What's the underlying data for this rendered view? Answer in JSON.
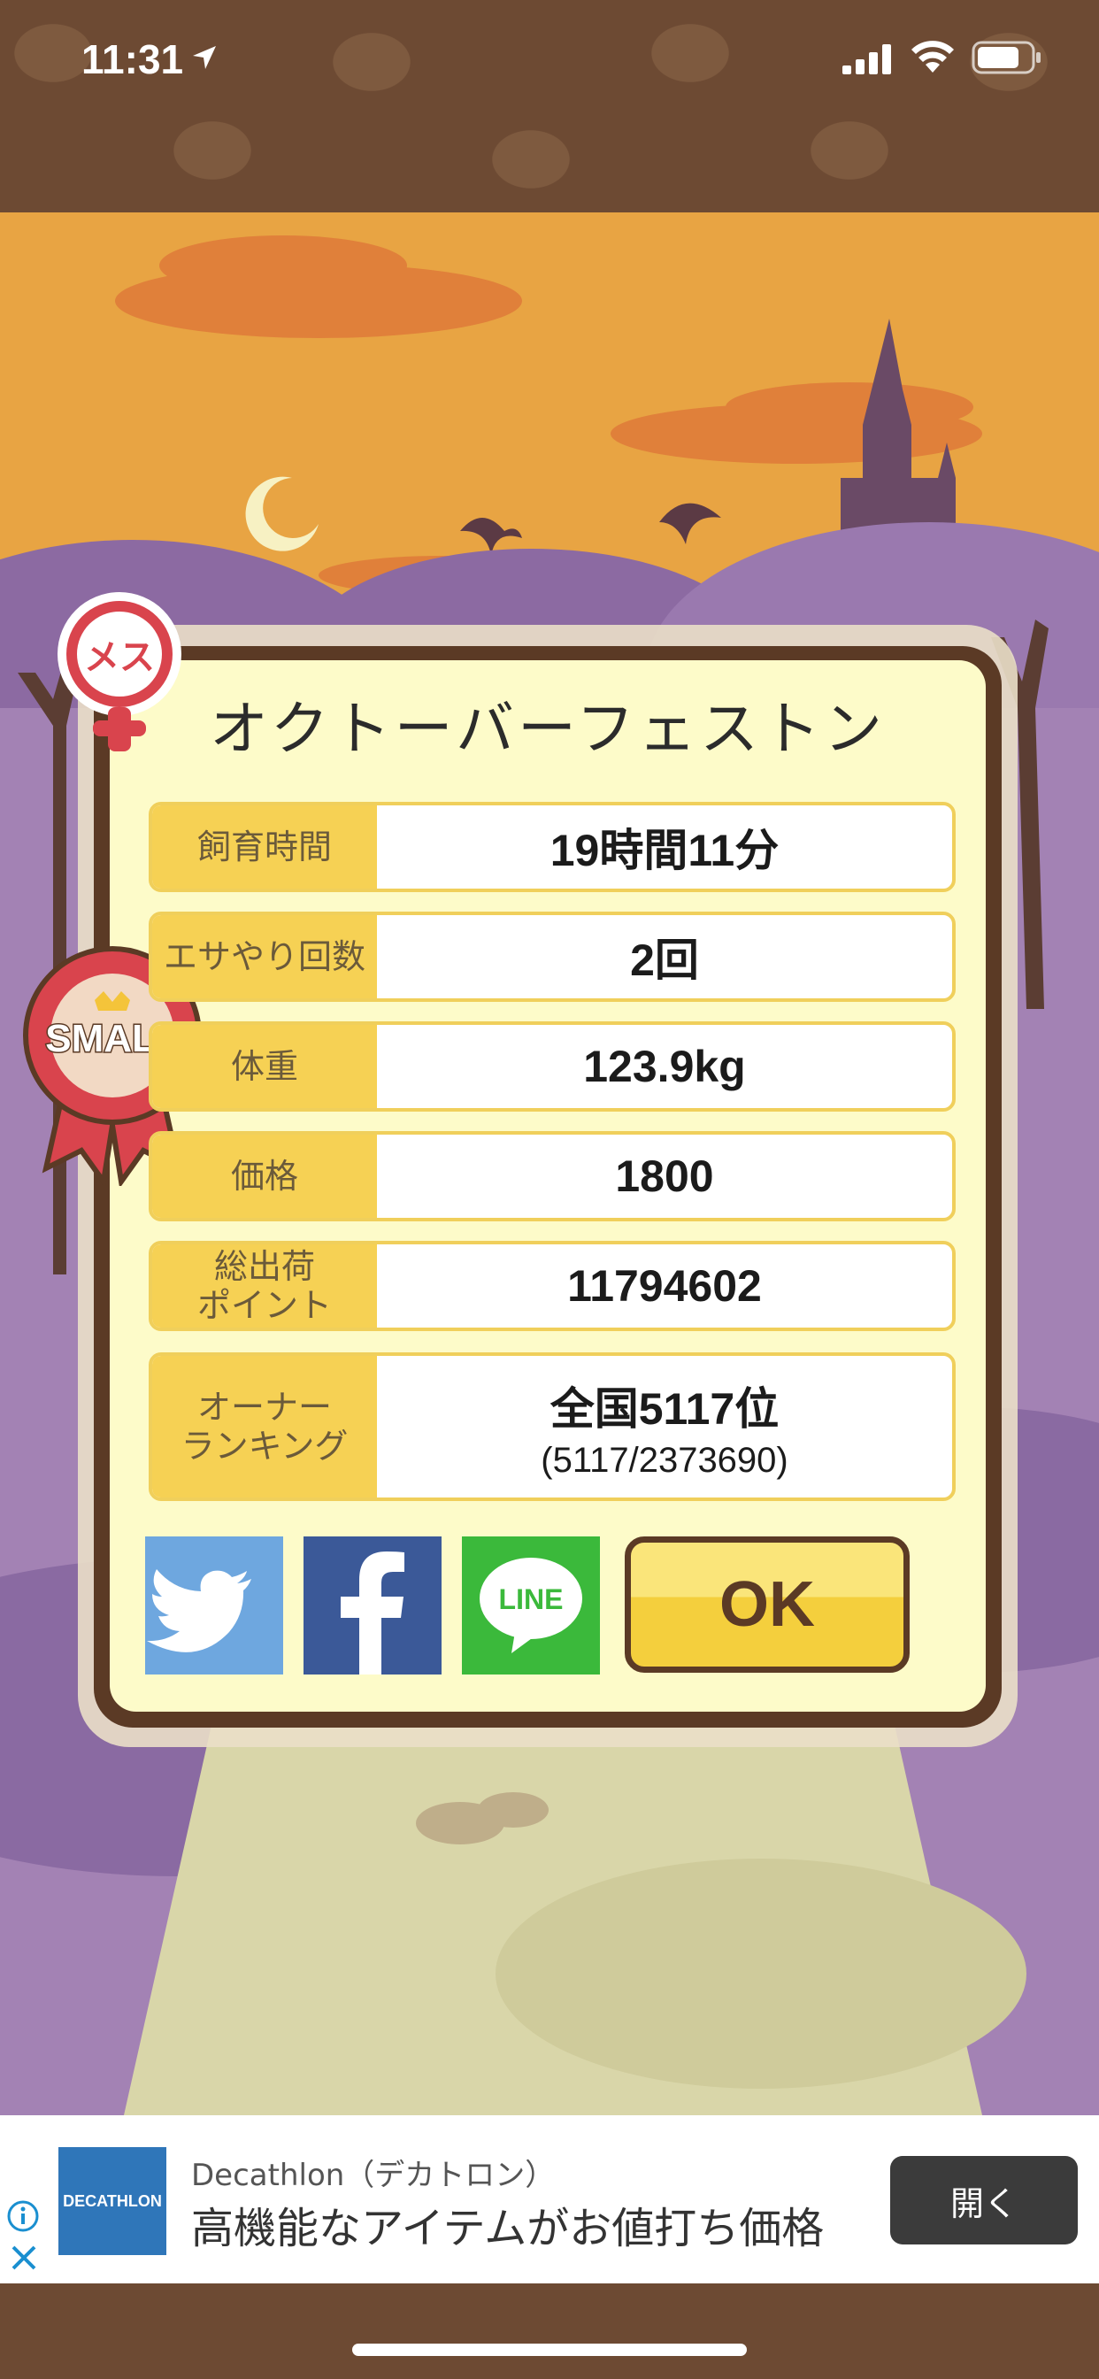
{
  "status_bar": {
    "time": "11:31",
    "icons": [
      "location-arrow-icon",
      "signal-icon",
      "wifi-icon",
      "battery-icon"
    ]
  },
  "card": {
    "gender_badge": "メス",
    "ribbon_label": "SMALL",
    "name": "オクトーバーフェストン",
    "rows": [
      {
        "label": "飼育時間",
        "value": "19時間11分"
      },
      {
        "label": "エサやり回数",
        "value": "2回"
      },
      {
        "label": "体重",
        "value": "123.9kg"
      },
      {
        "label": "価格",
        "value": "1800"
      },
      {
        "label_line1": "総出荷",
        "label_line2": "ポイント",
        "value": "11794602"
      },
      {
        "label_line1": "オーナー",
        "label_line2": "ランキング",
        "value": "全国5117位",
        "sub_value": "(5117/2373690)"
      }
    ],
    "share_buttons": {
      "twitter": "twitter-icon",
      "facebook": "facebook-icon",
      "line_label": "LINE"
    },
    "ok_label": "OK"
  },
  "ad": {
    "logo_text": "DECATHLON",
    "title": "Decathlon（デカトロン）",
    "text": "高機能なアイテムがお値打ち価格",
    "open_label": "開く"
  },
  "colors": {
    "sky": "#e8a443",
    "card_border": "#5b3a25",
    "card_fill": "#fdfbc9",
    "label_fill": "#f6d154",
    "twitter": "#6ea7df",
    "facebook": "#3b5998",
    "line": "#3bb93b"
  }
}
